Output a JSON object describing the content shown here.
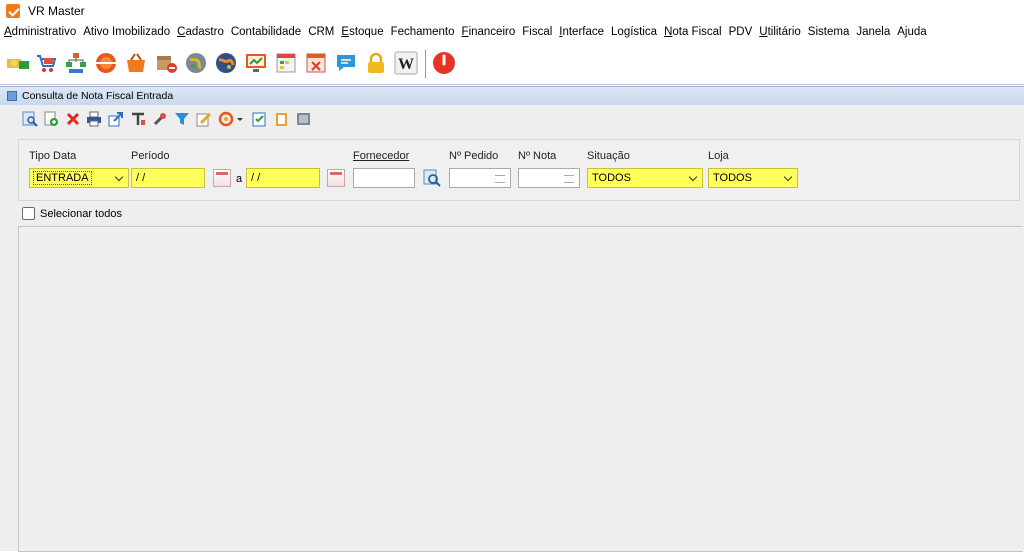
{
  "window": {
    "title": "VR Master"
  },
  "menu": [
    {
      "pre": "",
      "u": "A",
      "post": "dministrativo"
    },
    {
      "pre": "Ativo Imobilizado",
      "u": "",
      "post": ""
    },
    {
      "pre": "",
      "u": "C",
      "post": "adastro"
    },
    {
      "pre": "Contabilidade",
      "u": "",
      "post": ""
    },
    {
      "pre": "CRM",
      "u": "",
      "post": ""
    },
    {
      "pre": "",
      "u": "E",
      "post": "stoque"
    },
    {
      "pre": "Fechamento",
      "u": "",
      "post": ""
    },
    {
      "pre": "",
      "u": "F",
      "post": "inanceiro"
    },
    {
      "pre": "Fiscal",
      "u": "",
      "post": ""
    },
    {
      "pre": "",
      "u": "I",
      "post": "nterface"
    },
    {
      "pre": "Logística",
      "u": "",
      "post": ""
    },
    {
      "pre": "",
      "u": "N",
      "post": "ota Fiscal"
    },
    {
      "pre": "PDV",
      "u": "",
      "post": ""
    },
    {
      "pre": "",
      "u": "U",
      "post": "tilitário"
    },
    {
      "pre": "Sistema",
      "u": "",
      "post": ""
    },
    {
      "pre": "Janela",
      "u": "",
      "post": ""
    },
    {
      "pre": "Ajuda",
      "u": "",
      "post": ""
    }
  ],
  "toolbar_icons": [
    "money-icon",
    "cart-icon",
    "org-chart-icon",
    "badge-icon",
    "basket-icon",
    "box-icon",
    "globe-green-icon",
    "globe-orange-icon",
    "monitor-chart-icon",
    "calendar-grid-icon",
    "calendar-red-icon",
    "chat-icon",
    "lock-icon",
    "wikipedia-icon",
    "power-icon"
  ],
  "inner_window": {
    "title": "Consulta de Nota Fiscal Entrada"
  },
  "filters": {
    "tipo_data": {
      "label": "Tipo Data",
      "value": "ENTRADA"
    },
    "periodo": {
      "label": "Período",
      "from": " / /",
      "sep": "a",
      "to": " / /"
    },
    "fornecedor": {
      "label": "Fornecedor",
      "value": ""
    },
    "pedido": {
      "label": "Nº Pedido",
      "value": ""
    },
    "nota": {
      "label": "Nº Nota",
      "value": ""
    },
    "situacao": {
      "label": "Situação",
      "value": "TODOS"
    },
    "loja": {
      "label": "Loja",
      "value": "TODOS"
    }
  },
  "select_all": {
    "label": "Selecionar todos"
  },
  "colors": {
    "highlight": "#ffff5a",
    "accent": "#f07a1e"
  }
}
